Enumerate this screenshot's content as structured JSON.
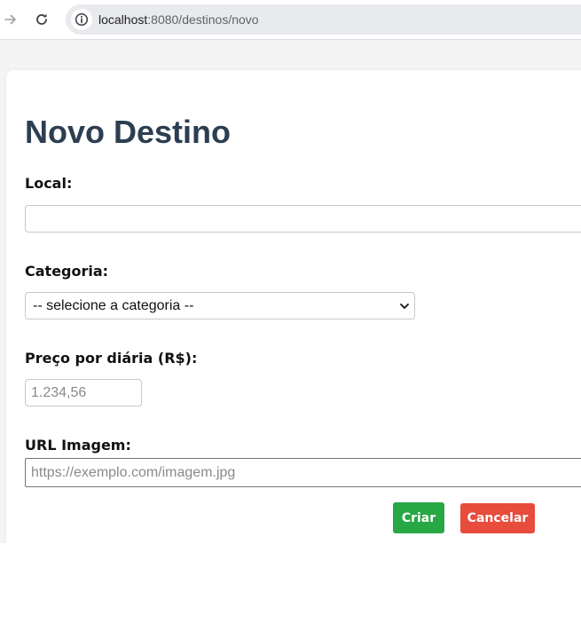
{
  "browser": {
    "url_host": "localhost",
    "url_path": ":8080/destinos/novo"
  },
  "form": {
    "title": "Novo Destino",
    "local": {
      "label": "Local:",
      "value": ""
    },
    "categoria": {
      "label": "Categoria:",
      "selected": "-- selecione a categoria --"
    },
    "preco": {
      "label": "Preço por diária (R$):",
      "placeholder": "1.234,56"
    },
    "imagem": {
      "label": "URL Imagem:",
      "placeholder": "https://exemplo.com/imagem.jpg"
    },
    "buttons": {
      "submit": "Criar",
      "cancel": "Cancelar"
    }
  },
  "icons": {
    "forward": "arrow-right-icon",
    "reload": "reload-icon",
    "info": "info-icon",
    "dropdown": "chevron-down-icon"
  },
  "colors": {
    "title": "#2c3e50",
    "submit": "#28a745",
    "cancel": "#e74c3c",
    "page_bg": "#f4f4f4"
  }
}
